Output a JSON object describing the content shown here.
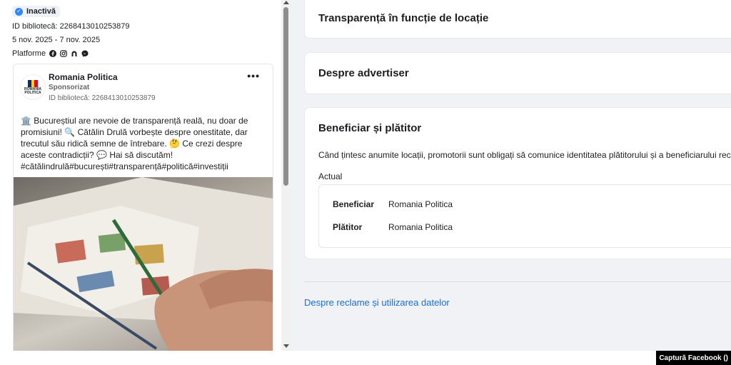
{
  "left": {
    "status": "Inactivă",
    "library_id": "ID bibliotecă: 2268413010253879",
    "date_range": "5 nov. 2025 - 7 nov. 2025",
    "platforms_label": "Platforme",
    "platform_icons": [
      "facebook-icon",
      "instagram-icon",
      "audience-network-icon",
      "messenger-icon"
    ]
  },
  "ad": {
    "advertiser": "Romania Politica",
    "logo_text": "ROMANIA POLITICA",
    "sponsored": "Sponsorizat",
    "library_id": "ID bibliotecă: 2268413010253879",
    "more": "•••",
    "text": "🏛️ Bucureștiul are nevoie de transparență reală, nu doar de promisiuni! 🔍 Cătălin Drulă vorbește despre onestitate, dar trecutul său ridică semne de întrebare. 🤔 Ce crezi despre aceste contradicții? 💬 Hai să discutăm! #cătălindrulă#bucurești#transparență#politică#investiții"
  },
  "right": {
    "sections": [
      {
        "title": "Transparență în funcție de locație"
      },
      {
        "title": "Despre advertiser"
      },
      {
        "title": "Beneficiar și plătitor"
      }
    ],
    "payer": {
      "description": "Când țintesc anumite locații, promotorii sunt obligați să comunice identitatea plătitorului și a beneficiarului reclamei.",
      "current_label": "Actual",
      "rows": [
        {
          "label": "Beneficiar",
          "value": "Romania Politica"
        },
        {
          "label": "Plătitor",
          "value": "Romania Politica"
        }
      ]
    },
    "footer_link": "Despre reclame și utilizarea datelor"
  },
  "caption": "Captură Facebook ()",
  "colors": {
    "accent": "#2d88ff",
    "link": "#1a6ed8",
    "panel_bg": "#f0f2f5"
  }
}
